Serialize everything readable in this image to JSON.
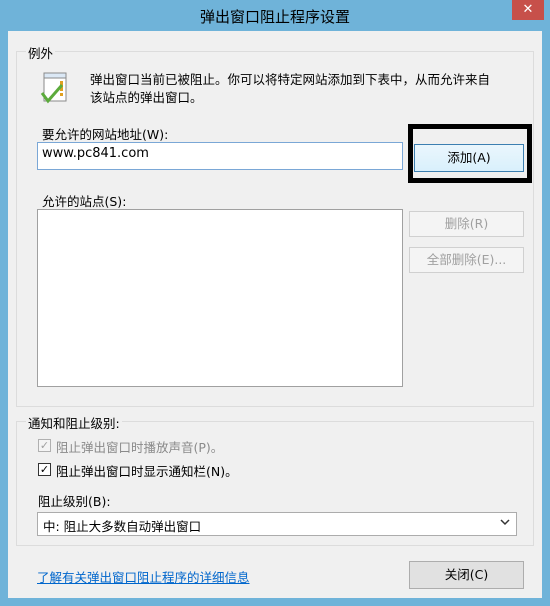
{
  "window": {
    "title": "弹出窗口阻止程序设置",
    "close_glyph": "✕"
  },
  "exceptions": {
    "group_label": "例外",
    "description": "弹出窗口当前已被阻止。你可以将特定网站添加到下表中，从而允许来自该站点的弹出窗口。",
    "address_label": "要允许的网站地址(W):",
    "address_value": "www.pc841.com",
    "add_button": "添加(A)",
    "allowed_label": "允许的站点(S):",
    "allowed_sites": [],
    "remove_button": "删除(R)",
    "remove_all_button": "全部删除(E)..."
  },
  "notify": {
    "group_label": "通知和阻止级别:",
    "play_sound_label": "阻止弹出窗口时播放声音(P)。",
    "play_sound_checked": true,
    "show_bar_label": "阻止弹出窗口时显示通知栏(N)。",
    "show_bar_checked": true,
    "level_label": "阻止级别(B):",
    "level_value": "中: 阻止大多数自动弹出窗口",
    "check_glyph": "✓"
  },
  "footer": {
    "learn_more_link": "了解有关弹出窗口阻止程序的详细信息",
    "close_button": "关闭(C)"
  },
  "colors": {
    "frame": "#6fb3d9",
    "close_red": "#c7504a",
    "link_blue": "#0066cc"
  }
}
